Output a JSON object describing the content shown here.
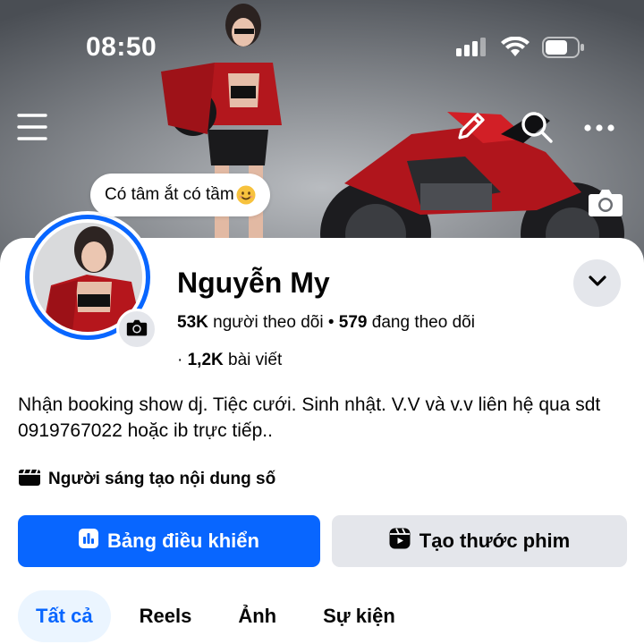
{
  "status_bar": {
    "time": "08:50"
  },
  "profile": {
    "note": "Có tâm ắt có tầm",
    "name": "Nguyễn My",
    "followers_count": "53K",
    "followers_label": "người theo dõi",
    "separator": "•",
    "following_count": "579",
    "following_label": "đang theo dõi",
    "posts_prefix": "·",
    "posts_count": "1,2K",
    "posts_label": "bài viết",
    "bio": "Nhận booking show dj. Tiệc cưới. Sinh nhật. V.V và v.v liên hệ qua sdt 0919767022 hoặc ib trực tiếp..",
    "category": "Người sáng tạo nội dung số"
  },
  "actions": {
    "dashboard_label": "Bảng điều khiển",
    "reel_label": "Tạo thước phim"
  },
  "tabs": [
    {
      "label": "Tất cả",
      "active": true
    },
    {
      "label": "Reels",
      "active": false
    },
    {
      "label": "Ảnh",
      "active": false
    },
    {
      "label": "Sự kiện",
      "active": false
    }
  ],
  "icons": {
    "nav": [
      "menu-icon",
      "pencil-icon",
      "search-icon",
      "more-icon"
    ],
    "cover": "camera-icon",
    "emoji": "smiling-face-emoji",
    "creator": "clapperboard-icon",
    "dashboard": "bar-chart-icon",
    "reel": "reel-icon"
  },
  "colors": {
    "accent": "#0866ff",
    "secondary_button": "#e4e6eb",
    "active_tab_bg": "#ebf5ff",
    "text": "#050505"
  }
}
